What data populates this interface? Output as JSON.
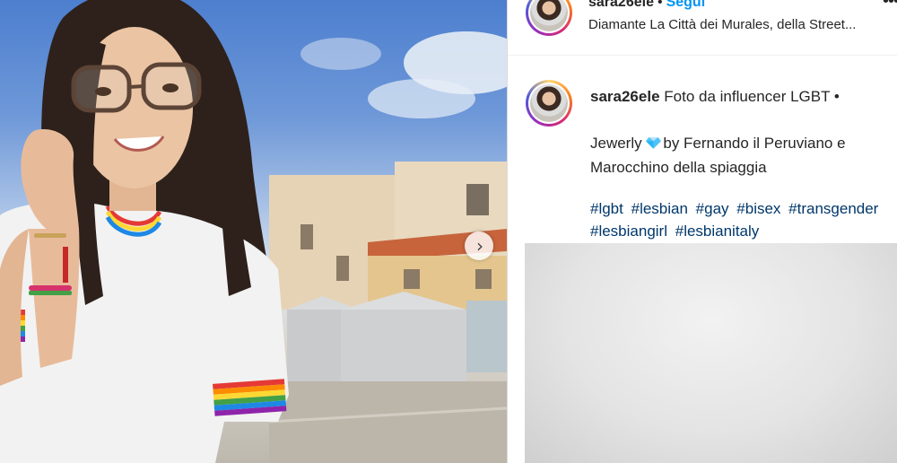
{
  "post": {
    "username": "sara26ele",
    "separator": "•",
    "follow_label": "Segui",
    "location": "Diamante La Città dei Murales, della Street...",
    "more_icon": "more-horizontal-icon",
    "caption": {
      "username": "sara26ele",
      "text_line1": "Foto da influencer LGBT •",
      "gem_icon": "gem-emoji-icon",
      "text_line2_part1": "Jewerly",
      "text_line2_part2": "by Fernando il Peruviano e Marocchino della spiaggia",
      "hashtags": [
        "#lgbt",
        "#lesbian",
        "#gay",
        "#bisex",
        "#transgender",
        "#lesbiangirl",
        "#lesbianitaly"
      ]
    }
  },
  "photo": {
    "next_icon": "chevron-right-icon",
    "colors": {
      "sky": "#4d7fcf",
      "building": "#e4c58e",
      "roof": "#c7643c",
      "shirt": "#f2f2f2"
    }
  }
}
